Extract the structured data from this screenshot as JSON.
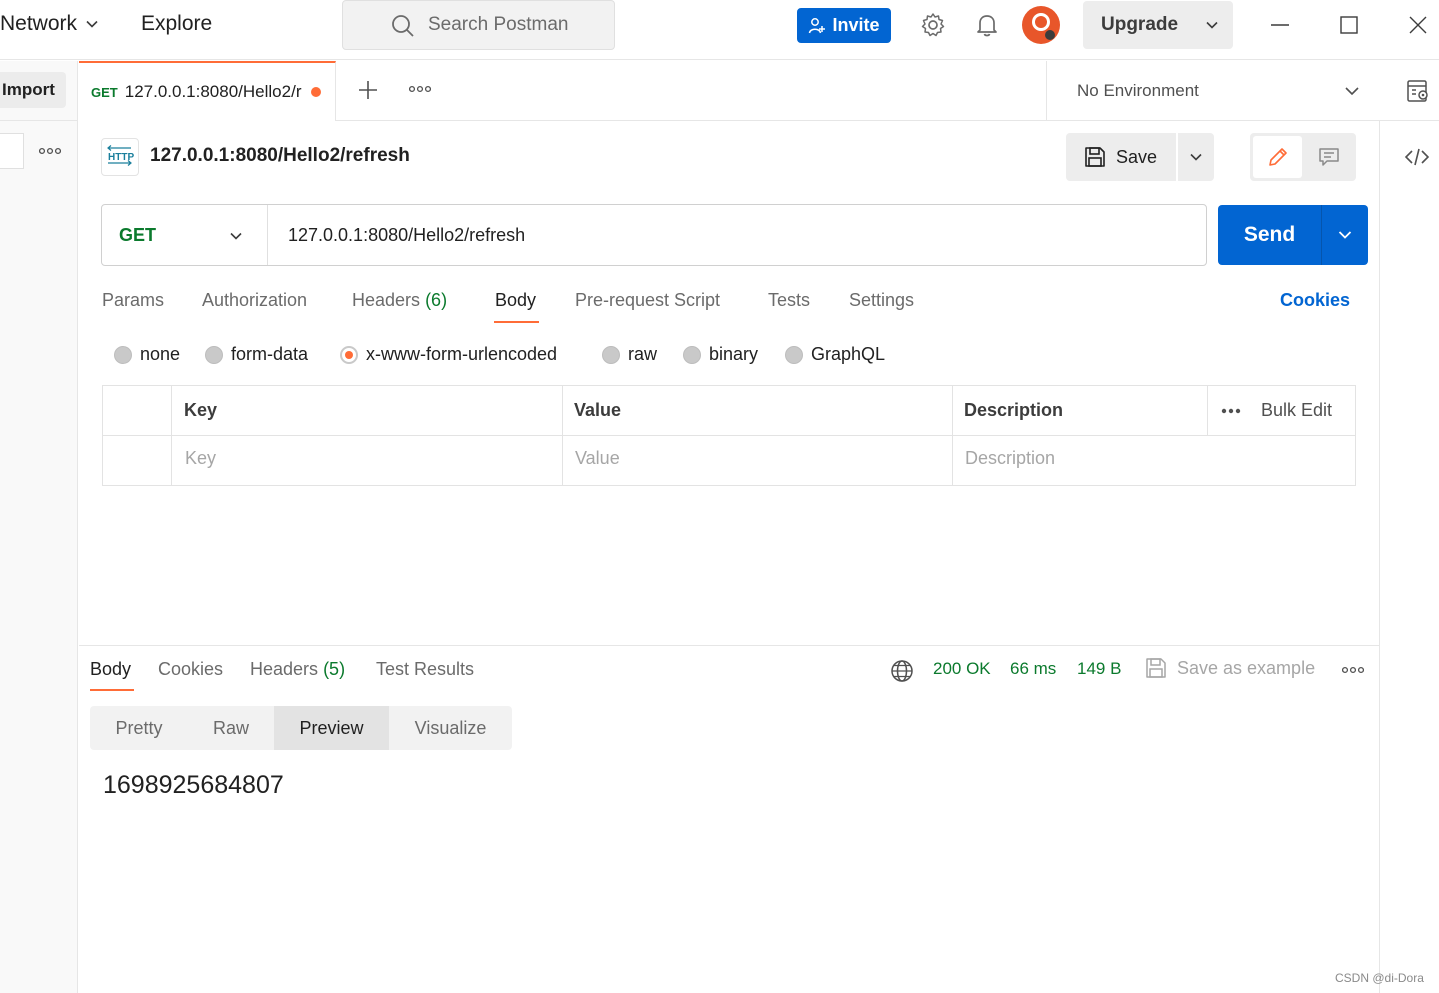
{
  "topbar": {
    "network_label": "Network",
    "explore_label": "Explore",
    "search_placeholder": "Search Postman",
    "invite_label": "Invite",
    "upgrade_label": "Upgrade"
  },
  "sidebar": {
    "import_label": "Import"
  },
  "tabs": {
    "active": {
      "method": "GET",
      "title": "127.0.0.1:8080/Hello2/r",
      "unsaved": true
    }
  },
  "environment": {
    "selected": "No Environment"
  },
  "request": {
    "title": "127.0.0.1:8080/Hello2/refresh",
    "save_label": "Save",
    "method": "GET",
    "url": "127.0.0.1:8080/Hello2/refresh",
    "send_label": "Send",
    "tabs": [
      {
        "label": "Params",
        "count": ""
      },
      {
        "label": "Authorization",
        "count": ""
      },
      {
        "label": "Headers",
        "count": "(6)"
      },
      {
        "label": "Body",
        "count": ""
      },
      {
        "label": "Pre-request Script",
        "count": ""
      },
      {
        "label": "Tests",
        "count": ""
      },
      {
        "label": "Settings",
        "count": ""
      }
    ],
    "active_tab": "Body",
    "cookies_label": "Cookies",
    "body_types": [
      "none",
      "form-data",
      "x-www-form-urlencoded",
      "raw",
      "binary",
      "GraphQL"
    ],
    "selected_body_type": "x-www-form-urlencoded",
    "table": {
      "headers": [
        "Key",
        "Value",
        "Description"
      ],
      "bulk_edit_label": "Bulk Edit",
      "placeholders": {
        "key": "Key",
        "value": "Value",
        "description": "Description"
      }
    }
  },
  "response": {
    "tabs": [
      {
        "label": "Body",
        "count": ""
      },
      {
        "label": "Cookies",
        "count": ""
      },
      {
        "label": "Headers",
        "count": "(5)"
      },
      {
        "label": "Test Results",
        "count": ""
      }
    ],
    "active_tab": "Body",
    "status": "200 OK",
    "time": "66 ms",
    "size": "149 B",
    "save_example_label": "Save as example",
    "views": [
      "Pretty",
      "Raw",
      "Preview",
      "Visualize"
    ],
    "active_view": "Preview",
    "body": "1698925684807"
  },
  "watermark": "CSDN @di-Dora",
  "colors": {
    "accent_orange": "#ff6c37",
    "primary_blue": "#0265d2",
    "success_green": "#0b7a2d"
  }
}
